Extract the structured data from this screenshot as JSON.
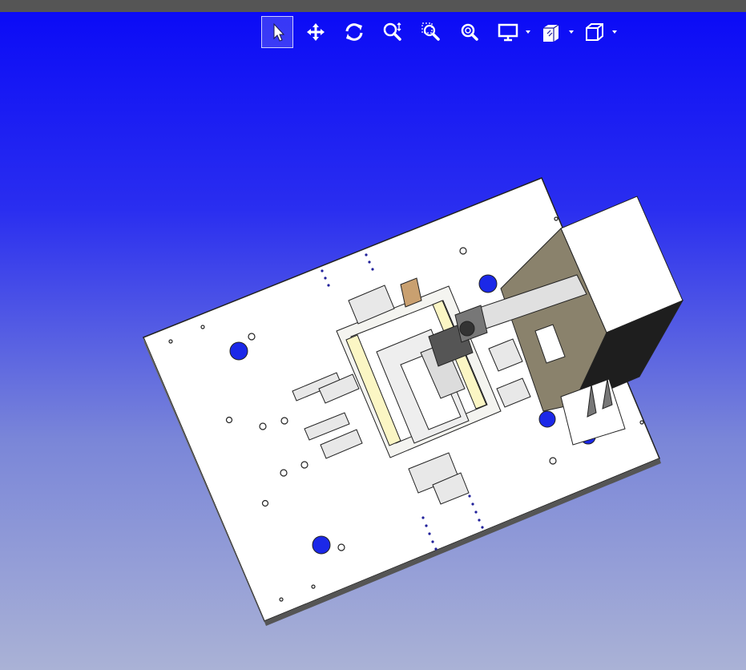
{
  "window": {
    "title": ""
  },
  "toolbar": {
    "tools": [
      {
        "name": "select-tool",
        "icon": "cursor-arrow-icon",
        "active": true
      },
      {
        "name": "pan-tool",
        "icon": "move-arrows-icon",
        "active": false
      },
      {
        "name": "rotate-tool",
        "icon": "rotate-icon",
        "active": false
      },
      {
        "name": "zoom-tool",
        "icon": "zoom-magnifier-icon",
        "active": false
      },
      {
        "name": "zoom-window-tool",
        "icon": "zoom-window-icon",
        "active": false
      },
      {
        "name": "zoom-fit-tool",
        "icon": "zoom-fit-icon",
        "active": false
      },
      {
        "name": "display-mode-dropdown",
        "icon": "monitor-icon",
        "active": false
      },
      {
        "name": "section-view-dropdown",
        "icon": "section-box-icon",
        "active": false
      },
      {
        "name": "view-orientation-dropdown",
        "icon": "cube-icon",
        "active": false
      }
    ]
  },
  "colors": {
    "background_top": "#0b0bf6",
    "background_bottom": "#aab2d6",
    "topbar": "#555555",
    "plate": "#ffffff",
    "housing": "#8a826c",
    "housing_dark": "#1e1e1e"
  }
}
